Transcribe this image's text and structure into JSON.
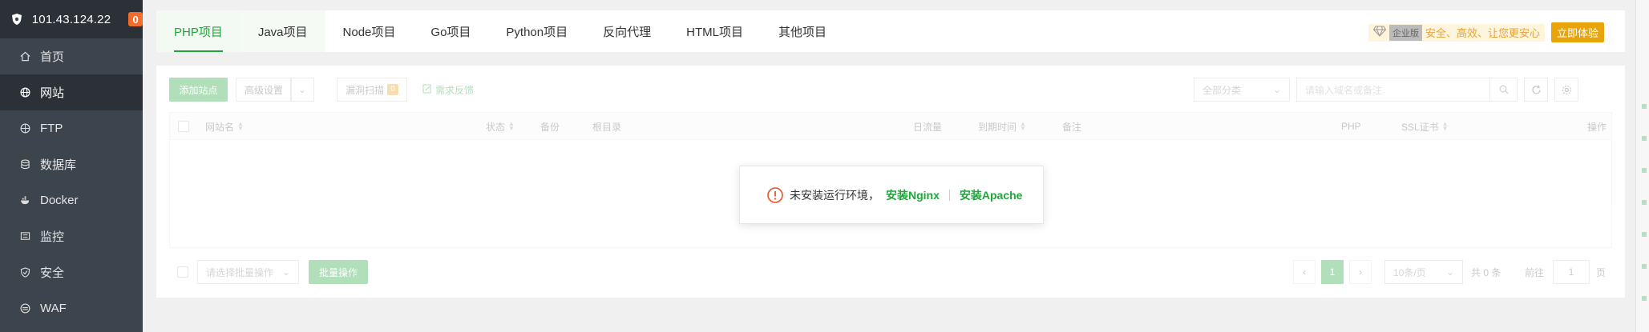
{
  "sidebar": {
    "ip": "101.43.124.22",
    "badge": "0",
    "items": [
      {
        "label": "首页",
        "icon": "home-icon"
      },
      {
        "label": "网站",
        "icon": "globe-icon",
        "active": true
      },
      {
        "label": "FTP",
        "icon": "ftp-icon"
      },
      {
        "label": "数据库",
        "icon": "database-icon"
      },
      {
        "label": "Docker",
        "icon": "docker-icon"
      },
      {
        "label": "监控",
        "icon": "monitor-icon"
      },
      {
        "label": "安全",
        "icon": "shield-icon"
      },
      {
        "label": "WAF",
        "icon": "waf-icon"
      }
    ]
  },
  "tabs": [
    {
      "label": "PHP项目"
    },
    {
      "label": "Java项目"
    },
    {
      "label": "Node项目"
    },
    {
      "label": "Go项目"
    },
    {
      "label": "Python项目"
    },
    {
      "label": "反向代理"
    },
    {
      "label": "HTML项目"
    },
    {
      "label": "其他项目"
    }
  ],
  "enterprise": {
    "tag": "企业版",
    "slogan": "安全、高效、让您更安心",
    "button": "立即体验"
  },
  "toolbar": {
    "add_site": "添加站点",
    "advanced": "高级设置",
    "vuln_scan": "漏洞扫描",
    "vuln_badge": "0",
    "feedback": "需求反馈",
    "category": "全部分类",
    "search_placeholder": "请输入域名或备注"
  },
  "table": {
    "columns": [
      "网站名",
      "状态",
      "备份",
      "根目录",
      "日流量",
      "到期时间",
      "备注",
      "PHP",
      "SSL证书",
      "操作"
    ]
  },
  "footer": {
    "batch_placeholder": "请选择批量操作",
    "batch_button": "批量操作",
    "page": "1",
    "page_size": "10条/页",
    "total": "共 0 条",
    "goto": "前往",
    "goto_value": "1",
    "page_suffix": "页"
  },
  "modal": {
    "message": "未安装运行环境，",
    "install_nginx": "安装Nginx",
    "install_apache": "安装Apache"
  },
  "colors": {
    "accent": "#20a53a",
    "sidebar_bg": "#3c444d",
    "warning": "#e6522c"
  }
}
